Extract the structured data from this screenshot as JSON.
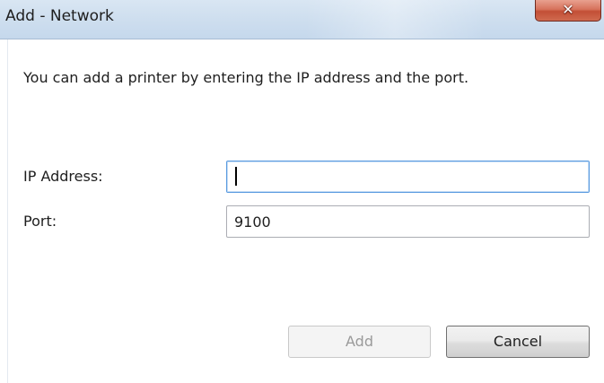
{
  "window": {
    "title": "Add  - Network",
    "close_icon": "x-close-icon"
  },
  "dialog": {
    "description": "You can add a printer by entering the IP address and the port.",
    "ip_label": "IP Address:",
    "ip_value": "",
    "port_label": "Port:",
    "port_value": "9100"
  },
  "buttons": {
    "add_label": "Add",
    "add_enabled": false,
    "cancel_label": "Cancel"
  },
  "colors": {
    "close_button": "#c95a41",
    "focus_border": "#5a9be0",
    "disabled_text": "#9a9a9a"
  }
}
